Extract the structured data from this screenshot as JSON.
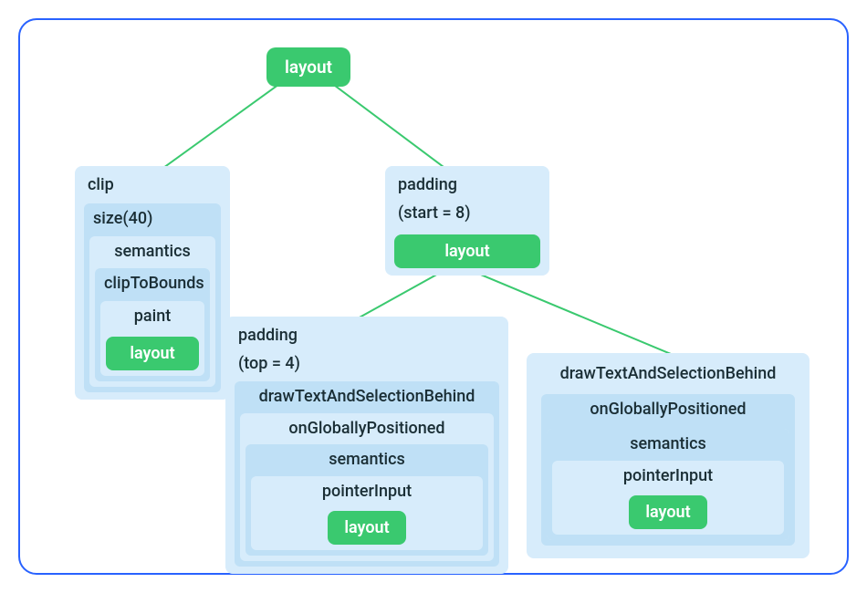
{
  "root": {
    "layout": "layout"
  },
  "left": {
    "clip": "clip",
    "size": "size(40)",
    "semantics": "semantics",
    "clipToBounds": "clipToBounds",
    "paint": "paint",
    "layout": "layout"
  },
  "mid": {
    "paddingLine1": "padding",
    "paddingLine2": "(start = 8)",
    "layout": "layout"
  },
  "bl": {
    "paddingLine1": "padding",
    "paddingLine2": "(top = 4)",
    "drawText": "drawTextAndSelectionBehind",
    "onGPos": "onGloballyPositioned",
    "semantics": "semantics",
    "pointerInput": "pointerInput",
    "layout": "layout"
  },
  "br": {
    "drawText": "drawTextAndSelectionBehind",
    "onGPos": "onGloballyPositioned",
    "semantics": "semantics",
    "pointerInput": "pointerInput",
    "layout": "layout"
  }
}
